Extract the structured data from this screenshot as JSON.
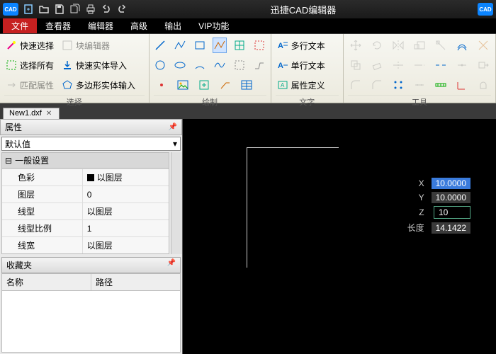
{
  "app": {
    "title": "迅捷CAD编辑器",
    "logo_text": "CAD"
  },
  "menus": {
    "file": "文件",
    "viewer": "查看器",
    "editor": "编辑器",
    "advanced": "高级",
    "output": "输出",
    "vip": "VIP功能"
  },
  "ribbon": {
    "select": {
      "title": "选择",
      "quick_select": "快速选择",
      "block_editor": "块编辑器",
      "select_all": "选择所有",
      "quick_entity_import": "快速实体导入",
      "match_props": "匹配属性",
      "polygon_entity_input": "多边形实体输入"
    },
    "draw": {
      "title": "绘制"
    },
    "text": {
      "title": "文字",
      "mtext": "多行文本",
      "stext": "单行文本",
      "attdef": "属性定义"
    },
    "tools": {
      "title": "工具"
    }
  },
  "doc": {
    "tab": "New1.dxf"
  },
  "props": {
    "panel_title": "属性",
    "default": "默认值",
    "section_general": "一般设置",
    "rows": {
      "color": "色彩",
      "color_val": "以图层",
      "layer": "图层",
      "layer_val": "0",
      "ltype": "线型",
      "ltype_val": "以图层",
      "ltscale": "线型比例",
      "ltscale_val": "1",
      "lweight": "线宽",
      "lweight_val": "以图层"
    }
  },
  "favorites": {
    "title": "收藏夹",
    "col_name": "名称",
    "col_path": "路径"
  },
  "coords": {
    "x_label": "X",
    "y_label": "Y",
    "z_label": "Z",
    "len_label": "长度",
    "x": "10.0000",
    "y": "10.0000",
    "z": "10",
    "len": "14.1422"
  }
}
